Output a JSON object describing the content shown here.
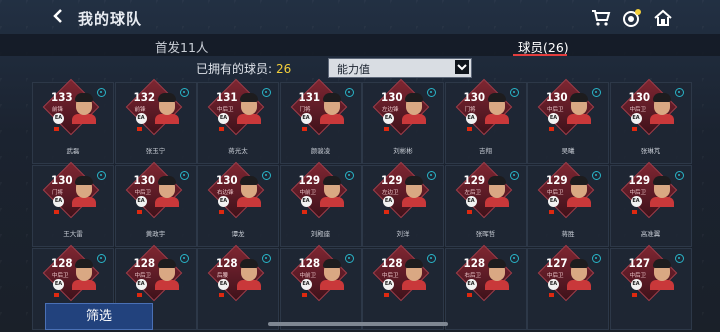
{
  "header": {
    "title": "我的球队"
  },
  "tabs": [
    {
      "label": "首发11人",
      "active": false
    },
    {
      "label": "球员(26)",
      "active": true
    }
  ],
  "owned": {
    "label": "已拥有的球员:",
    "count": "26"
  },
  "sort": {
    "value": "能力值"
  },
  "filter_button": "筛选",
  "colors": {
    "accent": "#e23d3d",
    "count": "#f3cf3b",
    "card": "#7e2631"
  },
  "players": [
    {
      "ovr": "133",
      "pos": "前锋",
      "name": "武磊"
    },
    {
      "ovr": "132",
      "pos": "前锋",
      "name": "张玉宁"
    },
    {
      "ovr": "131",
      "pos": "中后卫",
      "name": "蒋光太"
    },
    {
      "ovr": "131",
      "pos": "门将",
      "name": "颜骏凌"
    },
    {
      "ovr": "130",
      "pos": "左边锋",
      "name": "刘彬彬"
    },
    {
      "ovr": "130",
      "pos": "门将",
      "name": "吉翔"
    },
    {
      "ovr": "130",
      "pos": "中后卫",
      "name": "吴曦"
    },
    {
      "ovr": "130",
      "pos": "中后卫",
      "name": "张琳芃"
    },
    {
      "ovr": "130",
      "pos": "门将",
      "name": "王大雷"
    },
    {
      "ovr": "130",
      "pos": "中后卫",
      "name": "黄政宇"
    },
    {
      "ovr": "130",
      "pos": "右边锋",
      "name": "谭龙"
    },
    {
      "ovr": "129",
      "pos": "中前卫",
      "name": "刘殿座"
    },
    {
      "ovr": "129",
      "pos": "左边卫",
      "name": "刘洋"
    },
    {
      "ovr": "129",
      "pos": "左后卫",
      "name": "张晖哲"
    },
    {
      "ovr": "129",
      "pos": "中后卫",
      "name": "蒋胜"
    },
    {
      "ovr": "129",
      "pos": "中后卫",
      "name": "高准翼"
    },
    {
      "ovr": "128",
      "pos": "中后卫",
      "name": ""
    },
    {
      "ovr": "128",
      "pos": "中后卫",
      "name": ""
    },
    {
      "ovr": "128",
      "pos": "后腰",
      "name": ""
    },
    {
      "ovr": "128",
      "pos": "中前卫",
      "name": ""
    },
    {
      "ovr": "128",
      "pos": "中后卫",
      "name": ""
    },
    {
      "ovr": "128",
      "pos": "右后卫",
      "name": ""
    },
    {
      "ovr": "127",
      "pos": "中后卫",
      "name": ""
    },
    {
      "ovr": "127",
      "pos": "中后卫",
      "name": ""
    }
  ]
}
